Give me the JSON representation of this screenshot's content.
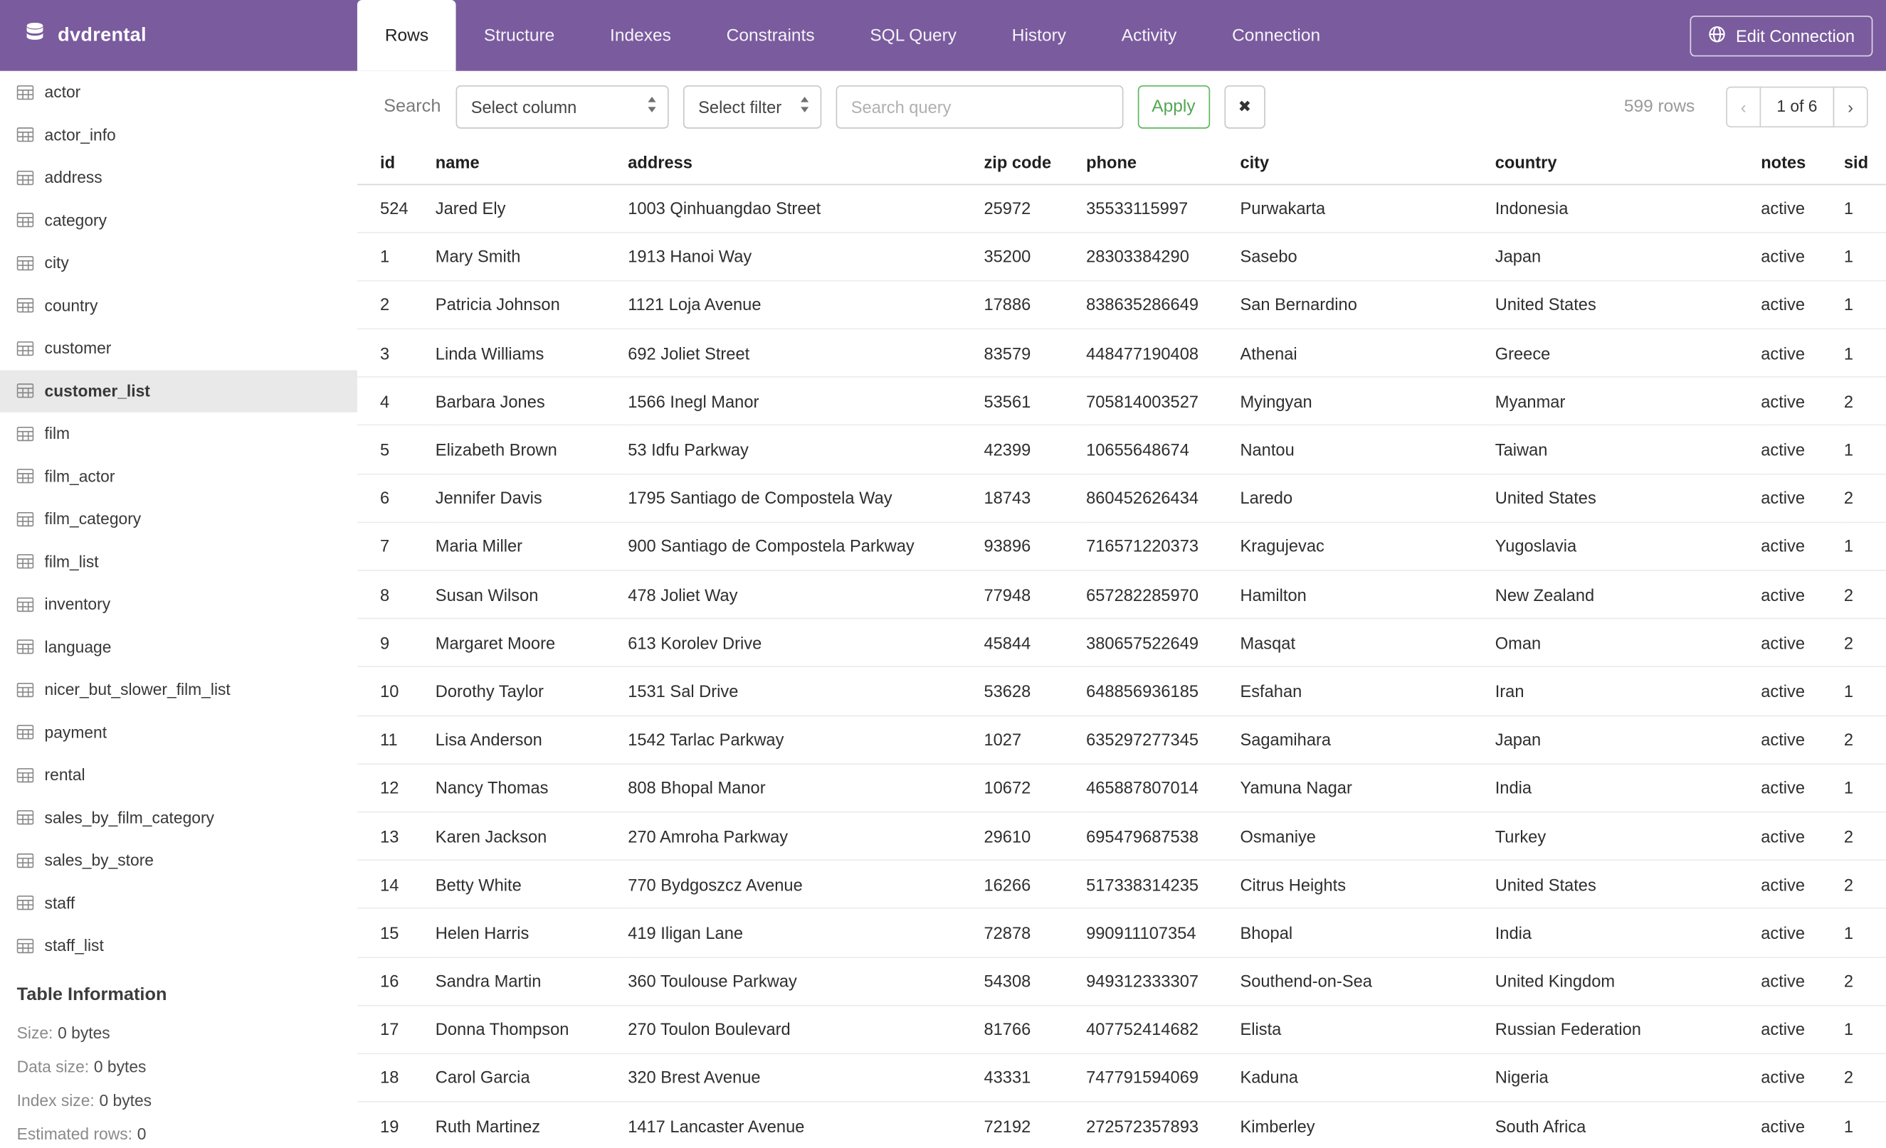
{
  "app": {
    "database_name": "dvdrental",
    "edit_connection_label": "Edit Connection"
  },
  "nav": {
    "tabs": [
      {
        "label": "Rows",
        "active": true
      },
      {
        "label": "Structure",
        "active": false
      },
      {
        "label": "Indexes",
        "active": false
      },
      {
        "label": "Constraints",
        "active": false
      },
      {
        "label": "SQL Query",
        "active": false
      },
      {
        "label": "History",
        "active": false
      },
      {
        "label": "Activity",
        "active": false
      },
      {
        "label": "Connection",
        "active": false
      }
    ]
  },
  "sidebar": {
    "tables": [
      "actor",
      "actor_info",
      "address",
      "category",
      "city",
      "country",
      "customer",
      "customer_list",
      "film",
      "film_actor",
      "film_category",
      "film_list",
      "inventory",
      "language",
      "nicer_but_slower_film_list",
      "payment",
      "rental",
      "sales_by_film_category",
      "sales_by_store",
      "staff",
      "staff_list"
    ],
    "selected": "customer_list",
    "table_info": {
      "heading": "Table Information",
      "rows": [
        {
          "label": "Size:",
          "value": "0 bytes"
        },
        {
          "label": "Data size:",
          "value": "0 bytes"
        },
        {
          "label": "Index size:",
          "value": "0 bytes"
        },
        {
          "label": "Estimated rows:",
          "value": "0"
        }
      ]
    }
  },
  "toolbar": {
    "search_label": "Search",
    "column_select": "Select column",
    "filter_select": "Select filter",
    "query_placeholder": "Search query",
    "query_value": "",
    "apply_label": "Apply",
    "clear_label": "✖",
    "rows_count": "599 rows",
    "pagination": {
      "prev": "‹",
      "current": "1 of 6",
      "next": "›"
    }
  },
  "table": {
    "columns": [
      "id",
      "name",
      "address",
      "zip code",
      "phone",
      "city",
      "country",
      "notes",
      "sid"
    ],
    "rows": [
      [
        "524",
        "Jared Ely",
        "1003 Qinhuangdao Street",
        "25972",
        "35533115997",
        "Purwakarta",
        "Indonesia",
        "active",
        "1"
      ],
      [
        "1",
        "Mary Smith",
        "1913 Hanoi Way",
        "35200",
        "28303384290",
        "Sasebo",
        "Japan",
        "active",
        "1"
      ],
      [
        "2",
        "Patricia Johnson",
        "1121 Loja Avenue",
        "17886",
        "838635286649",
        "San Bernardino",
        "United States",
        "active",
        "1"
      ],
      [
        "3",
        "Linda Williams",
        "692 Joliet Street",
        "83579",
        "448477190408",
        "Athenai",
        "Greece",
        "active",
        "1"
      ],
      [
        "4",
        "Barbara Jones",
        "1566 Inegl Manor",
        "53561",
        "705814003527",
        "Myingyan",
        "Myanmar",
        "active",
        "2"
      ],
      [
        "5",
        "Elizabeth Brown",
        "53 Idfu Parkway",
        "42399",
        "10655648674",
        "Nantou",
        "Taiwan",
        "active",
        "1"
      ],
      [
        "6",
        "Jennifer Davis",
        "1795 Santiago de Compostela Way",
        "18743",
        "860452626434",
        "Laredo",
        "United States",
        "active",
        "2"
      ],
      [
        "7",
        "Maria Miller",
        "900 Santiago de Compostela Parkway",
        "93896",
        "716571220373",
        "Kragujevac",
        "Yugoslavia",
        "active",
        "1"
      ],
      [
        "8",
        "Susan Wilson",
        "478 Joliet Way",
        "77948",
        "657282285970",
        "Hamilton",
        "New Zealand",
        "active",
        "2"
      ],
      [
        "9",
        "Margaret Moore",
        "613 Korolev Drive",
        "45844",
        "380657522649",
        "Masqat",
        "Oman",
        "active",
        "2"
      ],
      [
        "10",
        "Dorothy Taylor",
        "1531 Sal Drive",
        "53628",
        "648856936185",
        "Esfahan",
        "Iran",
        "active",
        "1"
      ],
      [
        "11",
        "Lisa Anderson",
        "1542 Tarlac Parkway",
        "1027",
        "635297277345",
        "Sagamihara",
        "Japan",
        "active",
        "2"
      ],
      [
        "12",
        "Nancy Thomas",
        "808 Bhopal Manor",
        "10672",
        "465887807014",
        "Yamuna Nagar",
        "India",
        "active",
        "1"
      ],
      [
        "13",
        "Karen Jackson",
        "270 Amroha Parkway",
        "29610",
        "695479687538",
        "Osmaniye",
        "Turkey",
        "active",
        "2"
      ],
      [
        "14",
        "Betty White",
        "770 Bydgoszcz Avenue",
        "16266",
        "517338314235",
        "Citrus Heights",
        "United States",
        "active",
        "2"
      ],
      [
        "15",
        "Helen Harris",
        "419 Iligan Lane",
        "72878",
        "990911107354",
        "Bhopal",
        "India",
        "active",
        "1"
      ],
      [
        "16",
        "Sandra Martin",
        "360 Toulouse Parkway",
        "54308",
        "949312333307",
        "Southend-on-Sea",
        "United Kingdom",
        "active",
        "2"
      ],
      [
        "17",
        "Donna Thompson",
        "270 Toulon Boulevard",
        "81766",
        "407752414682",
        "Elista",
        "Russian Federation",
        "active",
        "1"
      ],
      [
        "18",
        "Carol Garcia",
        "320 Brest Avenue",
        "43331",
        "747791594069",
        "Kaduna",
        "Nigeria",
        "active",
        "2"
      ],
      [
        "19",
        "Ruth Martinez",
        "1417 Lancaster Avenue",
        "72192",
        "272572357893",
        "Kimberley",
        "South Africa",
        "active",
        "1"
      ]
    ]
  }
}
